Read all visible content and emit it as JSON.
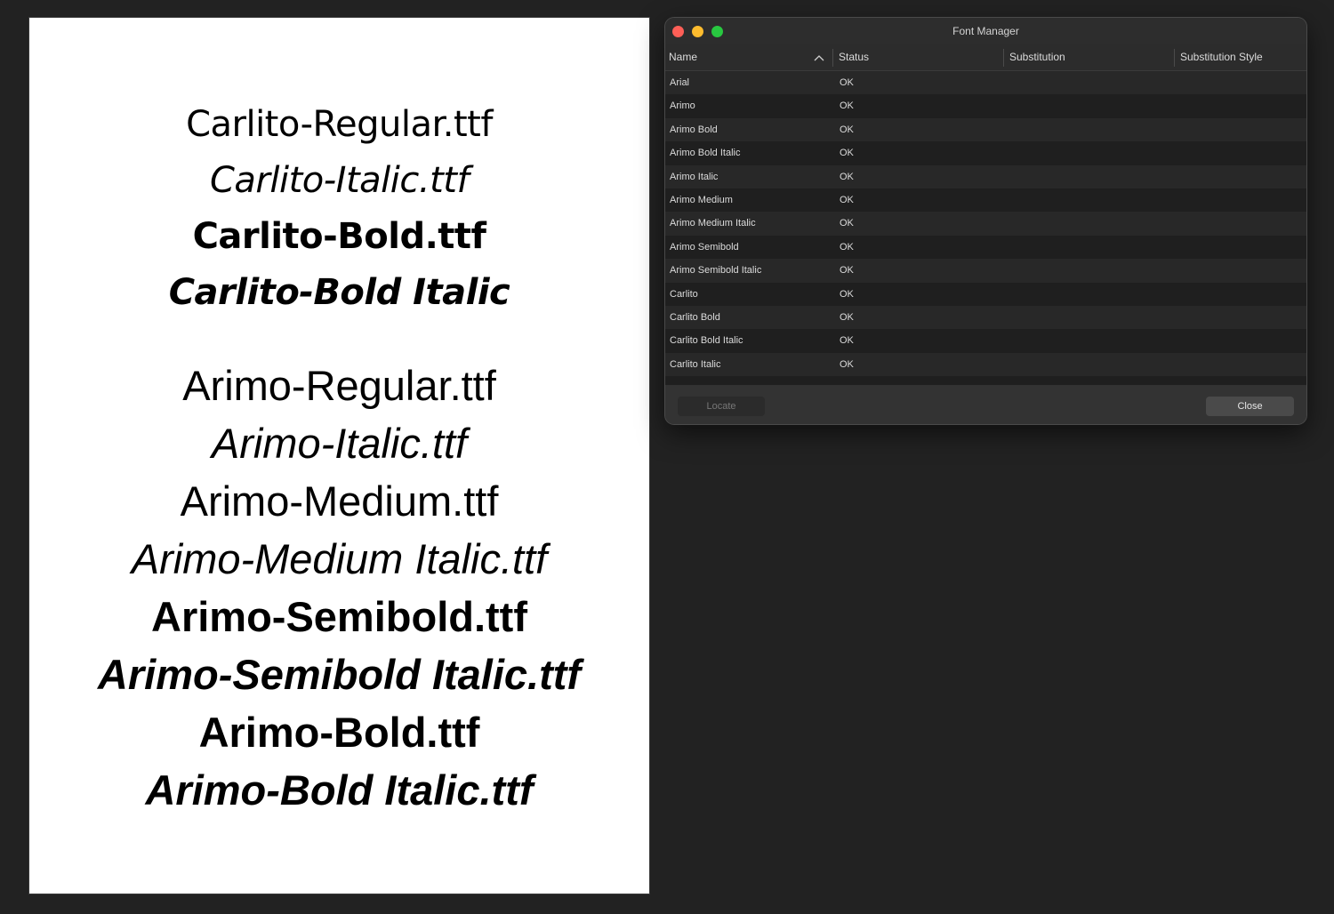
{
  "document": {
    "carlito_samples": [
      "Carlito-Regular.ttf",
      "Carlito-Italic.ttf",
      "Carlito-Bold.ttf",
      "Carlito-Bold Italic"
    ],
    "arimo_samples": [
      "Arimo-Regular.ttf",
      "Arimo-Italic.ttf",
      "Arimo-Medium.ttf",
      "Arimo-Medium Italic.ttf",
      "Arimo-Semibold.ttf",
      "Arimo-Semibold Italic.ttf",
      "Arimo-Bold.ttf",
      "Arimo-Bold Italic.ttf"
    ]
  },
  "dialog": {
    "title": "Font Manager",
    "columns": [
      "Name",
      "Status",
      "Substitution",
      "Substitution Style"
    ],
    "sort_icon": "chevron-up-icon",
    "rows": [
      {
        "name": "Arial",
        "status": "OK"
      },
      {
        "name": "Arimo",
        "status": "OK"
      },
      {
        "name": "Arimo Bold",
        "status": "OK"
      },
      {
        "name": "Arimo Bold Italic",
        "status": "OK"
      },
      {
        "name": "Arimo Italic",
        "status": "OK"
      },
      {
        "name": "Arimo Medium",
        "status": "OK"
      },
      {
        "name": "Arimo Medium Italic",
        "status": "OK"
      },
      {
        "name": "Arimo Semibold",
        "status": "OK"
      },
      {
        "name": "Arimo Semibold Italic",
        "status": "OK"
      },
      {
        "name": "Carlito",
        "status": "OK"
      },
      {
        "name": "Carlito Bold",
        "status": "OK"
      },
      {
        "name": "Carlito Bold Italic",
        "status": "OK"
      },
      {
        "name": "Carlito Italic",
        "status": "OK"
      }
    ],
    "buttons": {
      "locate": "Locate",
      "close": "Close"
    }
  },
  "colors": {
    "background": "#222222",
    "page": "#ffffff",
    "dialog": "#323232",
    "traffic_close": "#fe5f57",
    "traffic_minimize": "#febc2e",
    "traffic_zoom": "#28c840"
  }
}
